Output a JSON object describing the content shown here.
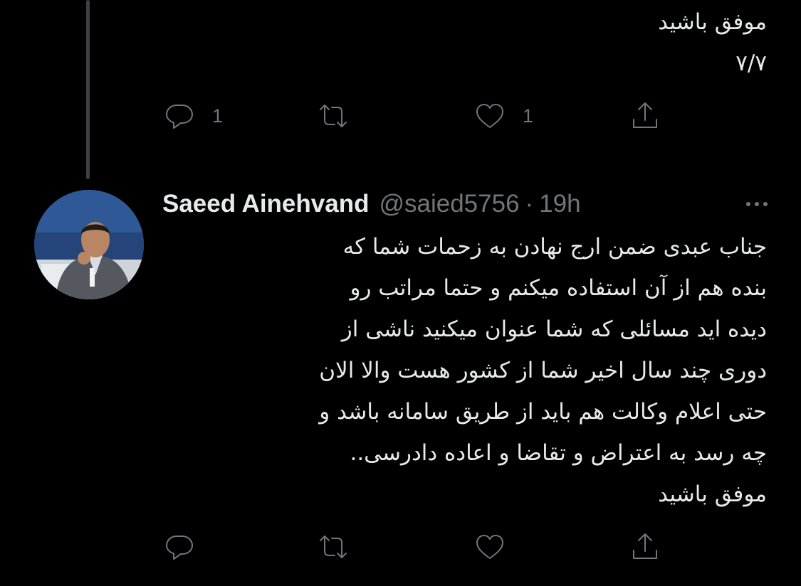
{
  "previous_tweet": {
    "lines": [
      "موفق باشید",
      "۷/۷"
    ],
    "actions": {
      "reply_count": "1",
      "retweet_count": "",
      "like_count": "1"
    }
  },
  "tweet": {
    "display_name": "Saeed Ainehvand",
    "handle": "@saied5756",
    "separator": "·",
    "time": "19h",
    "lines": [
      "جناب عبدی  ضمن ارج نهادن به زحمات شما که",
      "بنده هم از آن استفاده میکنم و حتما مراتب رو",
      "دیده اید مسائلی که شما عنوان میکنید  ناشی از",
      "دوری چند سال اخیر شما از کشور هست والا الان",
      "حتی اعلام وکالت هم باید از طریق سامانه باشد  و",
      "چه رسد به  اعتراض و تقاضا و اعاده دادرسی..",
      "موفق باشید"
    ],
    "actions": {
      "reply_count": "",
      "retweet_count": "",
      "like_count": ""
    }
  },
  "icons": [
    "reply-icon",
    "retweet-icon",
    "like-icon",
    "share-icon",
    "more-icon"
  ],
  "colors": {
    "background": "#000000",
    "text_primary": "#e7e9ea",
    "text_secondary": "#71767b",
    "thread_line": "#3e4144"
  }
}
